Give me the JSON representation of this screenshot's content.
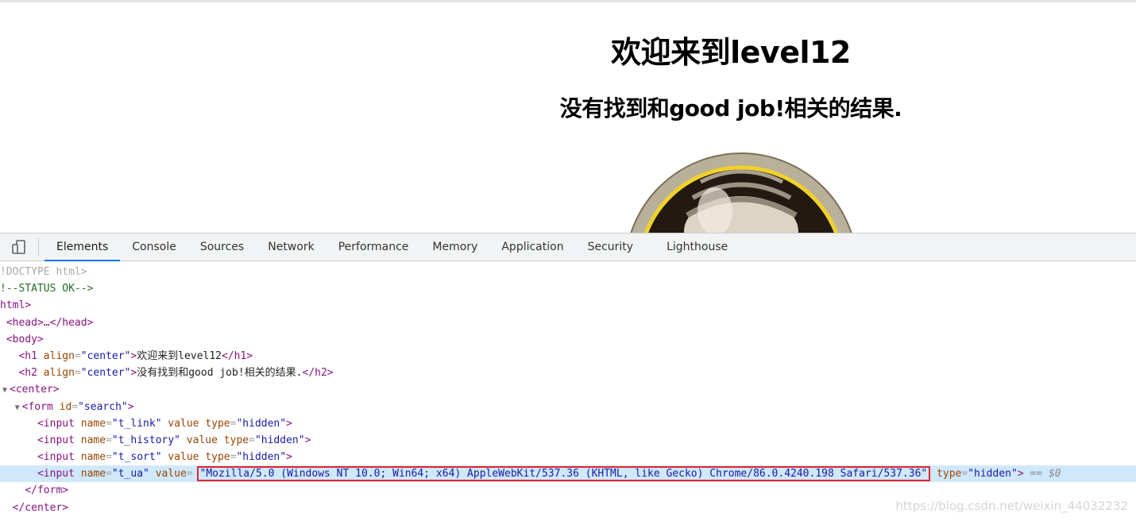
{
  "page": {
    "h1": "欢迎来到level12",
    "h2": "没有找到和good job!相关的结果."
  },
  "devtools": {
    "tabs": [
      "Elements",
      "Console",
      "Sources",
      "Network",
      "Performance",
      "Memory",
      "Application",
      "Security",
      "Lighthouse"
    ],
    "active_tab": "Elements",
    "device_toggle_icon": "device-toolbar-icon",
    "accent_color": "#1a73e8",
    "dom": {
      "doctype": "!DOCTYPE html>",
      "comment": "!--STATUS OK-->",
      "html_open": "html>",
      "head": "<head>…</head>",
      "body_open": "<body>",
      "h1_tag_open": "<h1",
      "h1_attr": "align",
      "h1_val": "\"center\"",
      "h1_text": "欢迎来到level12",
      "h1_close": "</h1>",
      "h2_tag_open": "<h2",
      "h2_attr": "align",
      "h2_val": "\"center\"",
      "h2_text": "没有找到和good job!相关的结果.",
      "h2_close": "</h2>",
      "center_open": "<center>",
      "form_tag": "<form",
      "form_attr": "id",
      "form_val": "\"search\"",
      "inputs": [
        {
          "name": "\"t_link\""
        },
        {
          "name": "\"t_history\""
        },
        {
          "name": "\"t_sort\""
        }
      ],
      "ua_input_name": "\"t_ua\"",
      "ua_value": "\"Mozilla/5.0 (Windows NT 10.0; Win64; x64) AppleWebKit/537.36 (KHTML, like Gecko) Chrome/86.0.4240.198 Safari/537.36\"",
      "input_type_val": "\"hidden\"",
      "selected_marker": "== $0",
      "form_close": "</form>",
      "center_close": "</center>"
    }
  },
  "watermark": "https://blog.csdn.net/weixin_44032232"
}
